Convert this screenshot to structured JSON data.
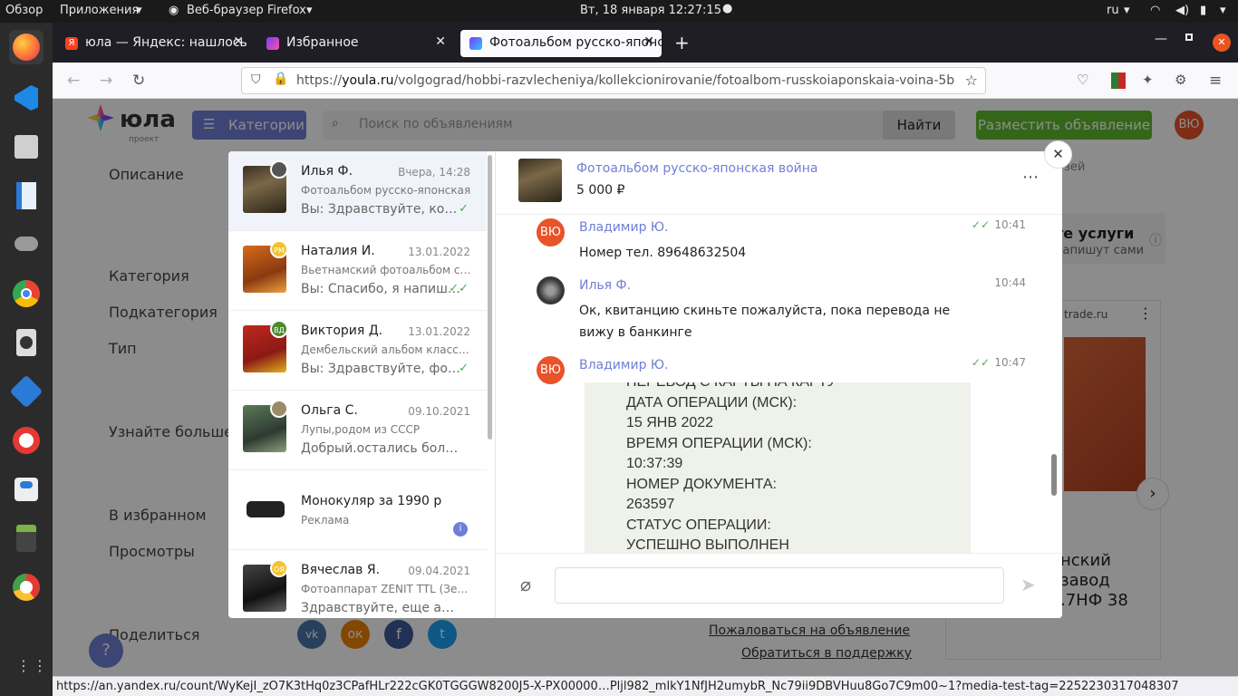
{
  "topbar": {
    "overview": "Обзор",
    "apps": "Приложения",
    "browser": "Веб-браузер Firefox",
    "datetime": "Вт, 18 января  12:27:15",
    "lang": "ru"
  },
  "tabs": [
    {
      "label": "юла — Яндекс: нашлось"
    },
    {
      "label": "Избранное"
    },
    {
      "label": "Фотоальбом русско-японская"
    }
  ],
  "url": {
    "prefix": "https://",
    "domain": "youla.ru",
    "path": "/volgograd/hobbi-razvlecheniya/kollekcionirovanie/fotoalbom-russkoiaponskaia-voina-5b"
  },
  "header": {
    "logo": "юла",
    "logo_sub": "проект",
    "categories": "Категории",
    "search_placeholder": "Поиск по объявлениям",
    "find": "Найти",
    "post": "Разместить объявление",
    "user_initials": "ВЮ"
  },
  "bg_left": {
    "description": "Описание",
    "category": "Категория",
    "subcategory": "Подкатегория",
    "type": "Тип",
    "learn_more": "Узнайте больше",
    "favorites": "В избранном",
    "views": "Просмотры",
    "share": "Поделиться"
  },
  "bg_right": {
    "frag1": "зей",
    "frag2": "те услуги",
    "frag3": "напишут сами",
    "ad_domain": "trade.ru",
    "ad_line1": "нский",
    "ad_line2": "завод",
    "ad_line3": ".7НФ 38"
  },
  "bg_bottom": {
    "report": "Пожаловаться на объявление",
    "support": "Обратиться в поддержку"
  },
  "conversations": [
    {
      "name": "Илья Ф.",
      "date": "Вчера, 14:28",
      "subject": "Фотоальбом русско-японская",
      "last": "Вы: Здравствуйте, когда",
      "checks": "✓"
    },
    {
      "name": "Наталия И.",
      "date": "13.01.2022",
      "subject": "Вьетнамский фотоальбом с лаковым",
      "last": "Вы: Спасибо, я напишу Вам",
      "checks": "✓✓",
      "badge": "РМ"
    },
    {
      "name": "Виктория Д.",
      "date": "13.01.2022",
      "subject": "Дембельский альбом классический",
      "last": "Вы: Здравствуйте, фото пришлите",
      "checks": "✓",
      "badge": "ВД"
    },
    {
      "name": "Ольга С.",
      "date": "09.10.2021",
      "subject": "Лупы,родом из СССР",
      "last": "Добрый.остались больше лупы"
    },
    {
      "name": "Монокуляр за 1990 р",
      "subject": "Реклама"
    },
    {
      "name": "Вячеслав Я.",
      "date": "09.04.2021",
      "subject": "Фотоаппарат ZENIT TTL (Зенит)",
      "last": "Здравствуйте, еще актуально?",
      "badge": "ОЯ"
    }
  ],
  "chat": {
    "title": "Фотоальбом русско-японская война",
    "price": "5 000 ₽",
    "messages": [
      {
        "author": "Владимир Ю.",
        "initials": "ВЮ",
        "time": "10:41",
        "text": "Номер тел. 89648632504"
      },
      {
        "author": "Илья Ф.",
        "time": "10:44",
        "text": "Ок, квитанцию скиньте пожалуйста, пока перевода не вижу в банкинге"
      },
      {
        "author": "Владимир Ю.",
        "initials": "ВЮ",
        "time": "10:47"
      }
    ],
    "receipt_lines": [
      "ПЕРЕВОД С КАРТЫ НА КАРТУ",
      "ДАТА ОПЕРАЦИИ (МСК):",
      "15 ЯНВ 2022",
      "ВРЕМЯ ОПЕРАЦИИ (МСК):",
      "10:37:39",
      "НОМЕР ДОКУМЕНТА:",
      "263597",
      "СТАТУС ОПЕРАЦИИ:",
      "УСПЕШНО ВЫПОЛНЕН"
    ]
  },
  "statusbar": "https://an.yandex.ru/count/WyKejI_zO7K3tHq0z3CPafHLr222cGK0TGGGW8200J5-X-PX00000…Pljl982_mlkY1NfJH2umybR_Nc79ii9DBVHuu8Go7C9m00~1?media-test-tag=2252230317048307",
  "colors": {
    "accent": "#6f7fd6",
    "user_avatar": "#e8532a",
    "green_button": "#5fbb2f",
    "check": "#4caf50"
  }
}
